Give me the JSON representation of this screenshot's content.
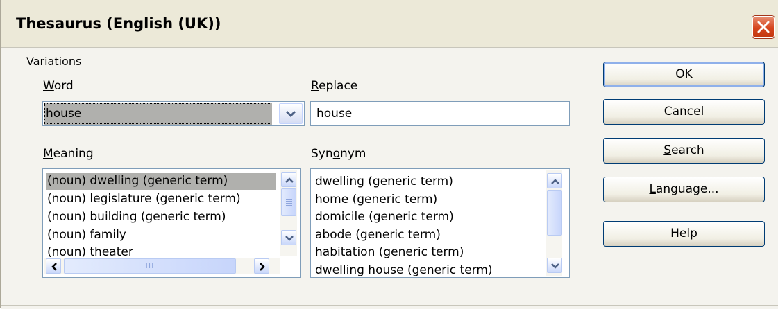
{
  "window": {
    "title": "Thesaurus (English (UK))"
  },
  "variations": {
    "group_label": "Variations",
    "word": {
      "label_access": "W",
      "label_rest": "ord",
      "value": "house"
    },
    "replace": {
      "label_access": "R",
      "label_rest": "eplace",
      "value": "house"
    },
    "meaning": {
      "label_access": "M",
      "label_rest": "eaning",
      "items": [
        "(noun) dwelling (generic term)",
        "(noun) legislature (generic term)",
        "(noun) building (generic term)",
        "(noun) family",
        "(noun) theater"
      ],
      "selected_index": 0,
      "hscroll_grip": "III"
    },
    "synonym": {
      "label_pre": "Syn",
      "label_access": "o",
      "label_rest": "nym",
      "items": [
        "dwelling (generic term)",
        "home (generic term)",
        "domicile (generic term)",
        "abode (generic term)",
        "habitation (generic term)",
        "dwelling house (generic term)"
      ]
    }
  },
  "buttons": {
    "ok": {
      "label": "OK"
    },
    "cancel": {
      "label": "Cancel"
    },
    "search": {
      "access": "S",
      "rest": "earch"
    },
    "language": {
      "access": "L",
      "rest": "anguage..."
    },
    "help": {
      "access": "H",
      "rest": "elp"
    }
  },
  "icons": {
    "close": "close-x-icon",
    "dropdown": "chevron-down-icon",
    "scroll_up": "chevron-up-icon",
    "scroll_down": "chevron-down-icon",
    "scroll_left": "chevron-left-icon",
    "scroll_right": "chevron-right-icon"
  },
  "colors": {
    "dialog_bg": "#f4f3ee",
    "selection": "#b0b0ad",
    "close_button": "#d6451e",
    "border": "#7f9db9"
  }
}
